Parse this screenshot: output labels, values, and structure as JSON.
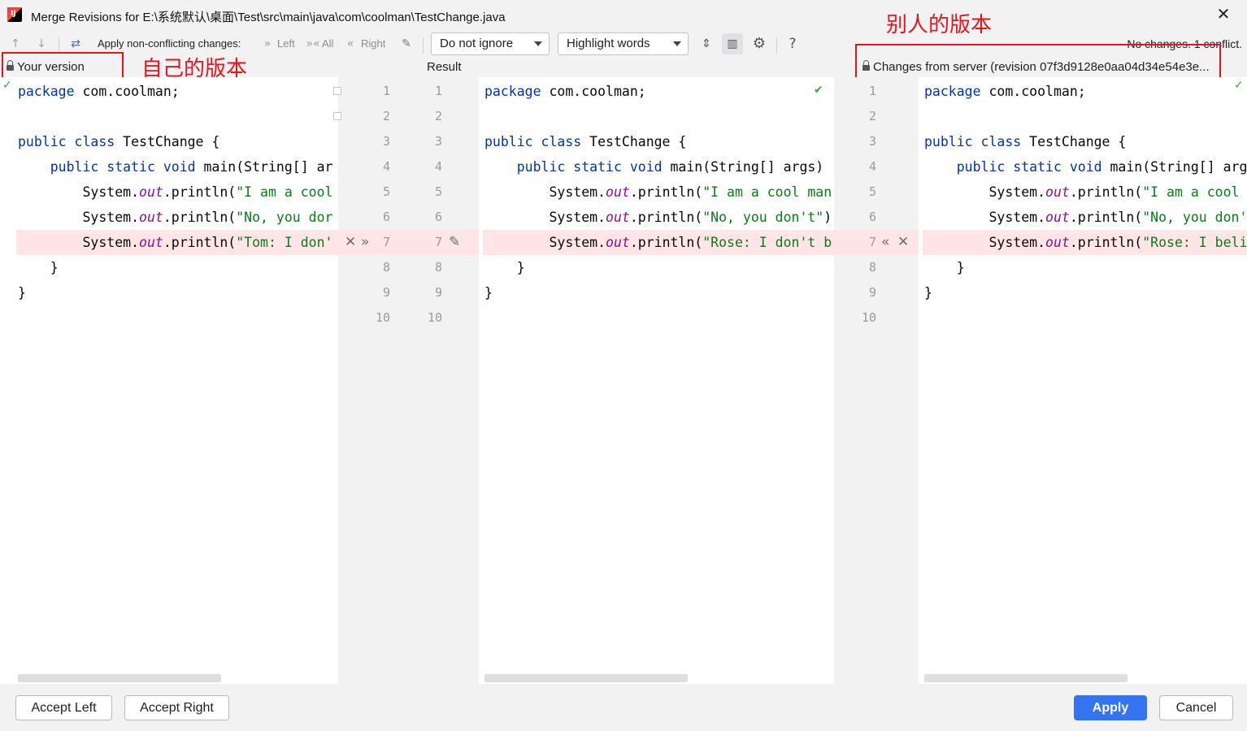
{
  "window": {
    "title": "Merge Revisions for E:\\系统默认\\桌面\\Test\\src\\main\\java\\com\\coolman\\TestChange.java",
    "close_glyph": "✕",
    "app_logo": "IJ"
  },
  "toolbar": {
    "apply_label": "Apply non-conflicting changes:",
    "left_label": "Left",
    "all_label": "All",
    "right_label": "Right",
    "ignore_select": "Do not ignore",
    "highlight_select": "Highlight words",
    "help_glyph": "?",
    "status": "No changes. 1 conflict."
  },
  "headers": {
    "left": "Your version",
    "center": "Result",
    "right": "Changes from server (revision 07f3d9128e0aa04d34e54e3e..."
  },
  "annotations": {
    "left": "自己的版本",
    "right": "别人的版本"
  },
  "line_numbers": [
    "1",
    "2",
    "3",
    "4",
    "5",
    "6",
    "7",
    "8",
    "9",
    "10"
  ],
  "left_pane": {
    "lines": [
      {
        "parts": [
          {
            "t": "package",
            "c": "kw"
          },
          {
            "t": " com.coolman;",
            "c": ""
          }
        ]
      },
      {
        "parts": []
      },
      {
        "parts": [
          {
            "t": "public class",
            "c": "kw"
          },
          {
            "t": " TestChange {",
            "c": ""
          }
        ]
      },
      {
        "parts": [
          {
            "t": "    ",
            "c": ""
          },
          {
            "t": "public static void",
            "c": "kw"
          },
          {
            "t": " main(String[] ar",
            "c": ""
          }
        ]
      },
      {
        "parts": [
          {
            "t": "        System.",
            "c": ""
          },
          {
            "t": "out",
            "c": "fld"
          },
          {
            "t": ".println(",
            "c": ""
          },
          {
            "t": "\"I am a cool",
            "c": "str"
          }
        ]
      },
      {
        "parts": [
          {
            "t": "        System.",
            "c": ""
          },
          {
            "t": "out",
            "c": "fld"
          },
          {
            "t": ".println(",
            "c": ""
          },
          {
            "t": "\"No, you dor",
            "c": "str"
          }
        ]
      },
      {
        "parts": [
          {
            "t": "        System.",
            "c": ""
          },
          {
            "t": "out",
            "c": "fld"
          },
          {
            "t": ".println(",
            "c": ""
          },
          {
            "t": "\"Tom: I don'",
            "c": "str"
          }
        ]
      },
      {
        "parts": [
          {
            "t": "    }",
            "c": ""
          }
        ]
      },
      {
        "parts": [
          {
            "t": "}",
            "c": ""
          }
        ]
      }
    ]
  },
  "center_pane": {
    "lines": [
      {
        "parts": [
          {
            "t": "package",
            "c": "kw"
          },
          {
            "t": " com.coolman;",
            "c": ""
          }
        ]
      },
      {
        "parts": []
      },
      {
        "parts": [
          {
            "t": "public class",
            "c": "kw"
          },
          {
            "t": " TestChange {",
            "c": ""
          }
        ]
      },
      {
        "parts": [
          {
            "t": "    ",
            "c": ""
          },
          {
            "t": "public static void",
            "c": "kw"
          },
          {
            "t": " main(String[] args)",
            "c": ""
          }
        ]
      },
      {
        "parts": [
          {
            "t": "        System.",
            "c": ""
          },
          {
            "t": "out",
            "c": "fld"
          },
          {
            "t": ".println(",
            "c": ""
          },
          {
            "t": "\"I am a cool man",
            "c": "str"
          }
        ]
      },
      {
        "parts": [
          {
            "t": "        System.",
            "c": ""
          },
          {
            "t": "out",
            "c": "fld"
          },
          {
            "t": ".println(",
            "c": ""
          },
          {
            "t": "\"No, you don't\"",
            "c": "str"
          },
          {
            "t": ")",
            "c": ""
          }
        ]
      },
      {
        "parts": [
          {
            "t": "        System.",
            "c": ""
          },
          {
            "t": "out",
            "c": "fld"
          },
          {
            "t": ".println(",
            "c": ""
          },
          {
            "t": "\"Rose: I don't b",
            "c": "str"
          }
        ]
      },
      {
        "parts": [
          {
            "t": "    }",
            "c": ""
          }
        ]
      },
      {
        "parts": [
          {
            "t": "}",
            "c": ""
          }
        ]
      }
    ]
  },
  "right_pane": {
    "lines": [
      {
        "parts": [
          {
            "t": "package",
            "c": "kw"
          },
          {
            "t": " com.coolman;",
            "c": ""
          }
        ]
      },
      {
        "parts": []
      },
      {
        "parts": [
          {
            "t": "public class",
            "c": "kw"
          },
          {
            "t": " TestChange {",
            "c": ""
          }
        ]
      },
      {
        "parts": [
          {
            "t": "    ",
            "c": ""
          },
          {
            "t": "public static void",
            "c": "kw"
          },
          {
            "t": " main(String[] arg",
            "c": ""
          }
        ]
      },
      {
        "parts": [
          {
            "t": "        System.",
            "c": ""
          },
          {
            "t": "out",
            "c": "fld"
          },
          {
            "t": ".println(",
            "c": ""
          },
          {
            "t": "\"I am a cool",
            "c": "str"
          }
        ]
      },
      {
        "parts": [
          {
            "t": "        System.",
            "c": ""
          },
          {
            "t": "out",
            "c": "fld"
          },
          {
            "t": ".println(",
            "c": ""
          },
          {
            "t": "\"No, you don'",
            "c": "str"
          }
        ]
      },
      {
        "parts": [
          {
            "t": "        System.",
            "c": ""
          },
          {
            "t": "out",
            "c": "fld"
          },
          {
            "t": ".println(",
            "c": ""
          },
          {
            "t": "\"Rose: I beli",
            "c": "str"
          }
        ]
      },
      {
        "parts": [
          {
            "t": "    }",
            "c": ""
          }
        ]
      },
      {
        "parts": [
          {
            "t": "}",
            "c": ""
          }
        ]
      }
    ]
  },
  "footer": {
    "accept_left": "Accept Left",
    "accept_right": "Accept Right",
    "apply": "Apply",
    "cancel": "Cancel"
  },
  "colors": {
    "keyword": "#0033b3",
    "string": "#067d17",
    "field": "#871094",
    "conflict_bg": "#ffe5e5",
    "primary_button": "#3574f0",
    "annotation_red": "#e8141b"
  }
}
